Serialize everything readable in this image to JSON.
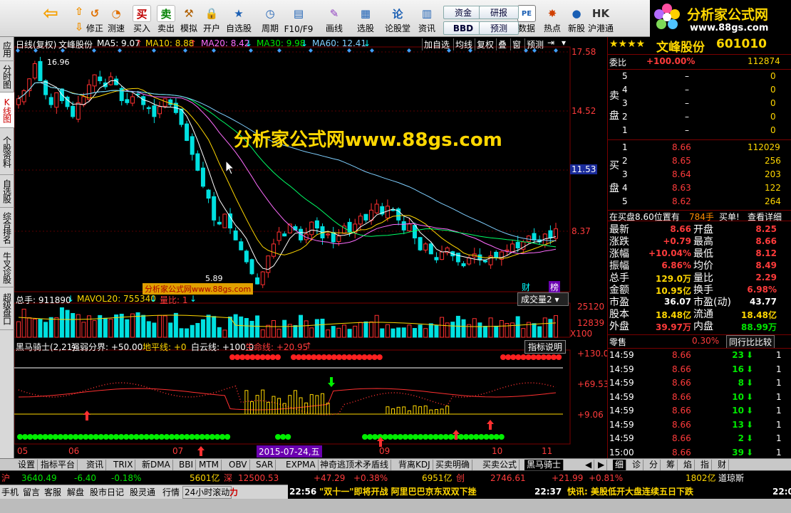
{
  "toolbar": {
    "buttons": [
      {
        "label": "修正",
        "icon": "undo-icon"
      },
      {
        "label": "测速",
        "icon": "speed-icon"
      },
      {
        "label": "买入",
        "icon": "buy-icon",
        "glyph": "买"
      },
      {
        "label": "卖出",
        "icon": "sell-icon",
        "glyph": "卖"
      },
      {
        "label": "模拟",
        "icon": "hammer-icon"
      },
      {
        "label": "开户",
        "icon": "lock-icon"
      },
      {
        "label": "自选股",
        "icon": "star-icon"
      },
      {
        "label": "周期",
        "icon": "clock-icon"
      },
      {
        "label": "F10/F9",
        "icon": "f10-icon"
      },
      {
        "label": "画线",
        "icon": "pen-icon"
      },
      {
        "label": "选股",
        "icon": "chart-icon"
      },
      {
        "label": "论股堂",
        "icon": "forum-icon",
        "glyph": "论"
      },
      {
        "label": "资讯",
        "icon": "news-icon"
      },
      {
        "label": "数据",
        "icon": "pe-icon",
        "glyph": "PE"
      },
      {
        "label": "热点",
        "icon": "hot-icon"
      },
      {
        "label": "新股",
        "icon": "newstock-icon"
      },
      {
        "label": "沪港通",
        "icon": "hk-icon"
      }
    ],
    "small": {
      "zijin": "资金",
      "bbd": "BBD",
      "yanbao": "研报",
      "yuce": "预测"
    }
  },
  "logo": {
    "title": "分析家公式网",
    "url": "www.88gs.com"
  },
  "lefttabs": [
    "应用",
    "分时图",
    "K线图",
    "个股资料",
    "自选股",
    "综合排名",
    "牛叉诊股",
    "超级盘口"
  ],
  "chart": {
    "header": {
      "period": "日线(复权)",
      "name": "文峰股份",
      "ma5": "MA5: 9.07",
      "ma10": "MA10: 8.88",
      "ma20": "MA20: 8.42",
      "ma30": "MA30: 9.98",
      "ma60": "MA60: 12.41"
    },
    "buttons": [
      "加自选",
      "均线",
      "复权",
      "叠",
      "窗",
      "预测"
    ],
    "yaxis": [
      "17.58",
      "14.52",
      "11.53",
      "8.37"
    ],
    "high_label": "16.96",
    "low_label": "5.89",
    "watermark": "分析家公式网www.88gs.com",
    "watermark_small": "分析家公式网www.88gs.com",
    "badges": [
      "财",
      "榜"
    ],
    "volume": {
      "total": "总手: 911890",
      "mavol": "MAVOL20: 755340",
      "ratio": "量比: 1",
      "selector": "成交量2",
      "y": [
        "25120",
        "12839",
        "X100"
      ]
    },
    "indicator": {
      "name": "黑马骑士(2,21)",
      "strength": "强弱分界: +50.00",
      "ground": "地平线: +0",
      "cloud": "白云线: +100.0",
      "life": "生命线: +20.95",
      "help": "指标说明",
      "y": [
        "+130.0",
        "+69.53",
        "+9.06"
      ]
    },
    "dates": [
      "05",
      "06",
      "07",
      "09",
      "10",
      "11"
    ],
    "cursor_date": "2015-07-24,五"
  },
  "chart_data": {
    "type": "candlestick",
    "y_range": [
      5.5,
      17.8
    ],
    "close": [
      15.2,
      15.6,
      16.2,
      16.96,
      16.1,
      15.4,
      14.9,
      15.5,
      15.1,
      14.8,
      14.3,
      15.0,
      15.3,
      15.9,
      16.4,
      16.1,
      15.8,
      16.3,
      15.9,
      15.1,
      15.0,
      15.3,
      15.4,
      14.9,
      14.7,
      14.3,
      14.8,
      15.2,
      14.9,
      14.5,
      13.9,
      13.1,
      12.4,
      11.6,
      10.8,
      10.2,
      9.1,
      8.9,
      9.4,
      8.7,
      8.1,
      7.6,
      7.0,
      6.4,
      5.89,
      6.5,
      7.3,
      7.9,
      8.5,
      8.3,
      8.9,
      8.6,
      8.1,
      8.4,
      9.0,
      8.7,
      8.2,
      8.4,
      8.0,
      8.3,
      8.8,
      8.5,
      8.9,
      9.3,
      9.1,
      9.6,
      9.9,
      9.4,
      9.8,
      9.6,
      9.1,
      8.6,
      8.9,
      8.2,
      7.6,
      7.9,
      7.4,
      7.1,
      7.5,
      7.7,
      7.3,
      7.0,
      6.8,
      7.2,
      7.4,
      7.1,
      7.0,
      7.3,
      7.2,
      7.5,
      7.6,
      7.9,
      7.7,
      8.0,
      8.3,
      8.1,
      8.0,
      8.4,
      8.2,
      8.66
    ],
    "volume_total": 911890
  },
  "quote": {
    "stars": "★★★★",
    "name": "文峰股份",
    "code": "601010",
    "weibi": {
      "label": "委比",
      "value": "+100.00%",
      "amount": "112874"
    },
    "sell": [
      {
        "lvl": "5",
        "price": "–",
        "vol": "0"
      },
      {
        "lvl": "4",
        "price": "–",
        "vol": "0"
      },
      {
        "lvl": "3",
        "price": "–",
        "vol": "0"
      },
      {
        "lvl": "2",
        "price": "–",
        "vol": "0"
      },
      {
        "lvl": "1",
        "price": "–",
        "vol": "0"
      }
    ],
    "buy": [
      {
        "lvl": "1",
        "price": "8.66",
        "vol": "112029"
      },
      {
        "lvl": "2",
        "price": "8.65",
        "vol": "256"
      },
      {
        "lvl": "3",
        "price": "8.64",
        "vol": "203"
      },
      {
        "lvl": "4",
        "price": "8.63",
        "vol": "122"
      },
      {
        "lvl": "5",
        "price": "8.62",
        "vol": "264"
      }
    ],
    "sell_label": [
      "卖",
      "盘"
    ],
    "buy_label": [
      "买",
      "盘"
    ],
    "notice": "在买盘8.60位置有",
    "notice_vol": "784手",
    "notice_action": "买单!",
    "notice_link": "查看详细",
    "stats": [
      [
        "最新",
        "8.66",
        "开盘",
        "8.25"
      ],
      [
        "涨跌",
        "+0.79",
        "最高",
        "8.66"
      ],
      [
        "涨幅",
        "+10.04%",
        "最低",
        "8.12"
      ],
      [
        "振幅",
        "6.86%",
        "均价",
        "8.49"
      ],
      [
        "总手",
        "129.0万",
        "量比",
        "2.29"
      ],
      [
        "金额",
        "10.95亿",
        "换手",
        "6.98%"
      ],
      [
        "市盈",
        "36.07",
        "市盈(动)",
        "43.77"
      ],
      [
        "股本",
        "18.48亿",
        "流通",
        "18.48亿"
      ],
      [
        "外盘",
        "39.97万",
        "内盘",
        "88.99万"
      ]
    ],
    "lingshou": "零售",
    "lingshou_pct": "0.30%",
    "peer_btn": "同行比比较",
    "ticks": [
      [
        "14:59",
        "8.66",
        "23",
        "1"
      ],
      [
        "14:59",
        "8.66",
        "16",
        "1"
      ],
      [
        "14:59",
        "8.66",
        "8",
        "1"
      ],
      [
        "14:59",
        "8.66",
        "10",
        "1"
      ],
      [
        "14:59",
        "8.66",
        "10",
        "1"
      ],
      [
        "14:59",
        "8.66",
        "13",
        "1"
      ],
      [
        "14:59",
        "8.66",
        "2",
        "1"
      ],
      [
        "15:00",
        "8.66",
        "39",
        "1"
      ]
    ]
  },
  "bottomtabs": [
    "设置",
    "指标平台",
    "资讯",
    "TRIX",
    "新DMA",
    "BBI",
    "MTM",
    "OBV",
    "SAR",
    "EXPMA",
    "神奇逃顶术矛盾线",
    "背离KDJ",
    "买卖明确",
    "买卖公式",
    "黑马骑士"
  ],
  "righttabs": [
    "细",
    "诊",
    "分",
    "筹",
    "焰",
    "指",
    "财"
  ],
  "index": [
    {
      "name": "沪",
      "value": "3640.49",
      "chg": "-6.40",
      "pct": "-0.18%",
      "amt": "5601亿"
    },
    {
      "name": "深",
      "value": "12500.53",
      "chg": "+47.29",
      "pct": "+0.38%",
      "amt": "6951亿"
    },
    {
      "name": "创",
      "value": "2746.61",
      "chg": "+21.99",
      "pct": "+0.81%",
      "amt": "1802亿"
    },
    {
      "name": "道琼斯"
    }
  ],
  "status": {
    "items": [
      "手机",
      "留言",
      "客服",
      "解盘",
      "股市日记",
      "股灵通",
      "行情",
      "24小时滚动"
    ],
    "power": "力",
    "news1_time": "22:56",
    "news1": "\"双十一\"即将开战 阿里巴巴京东双双下挫",
    "news2_time": "22:37",
    "news2": "快讯: 美股低开大盘连续五日下跌",
    "clock": "22:0"
  }
}
